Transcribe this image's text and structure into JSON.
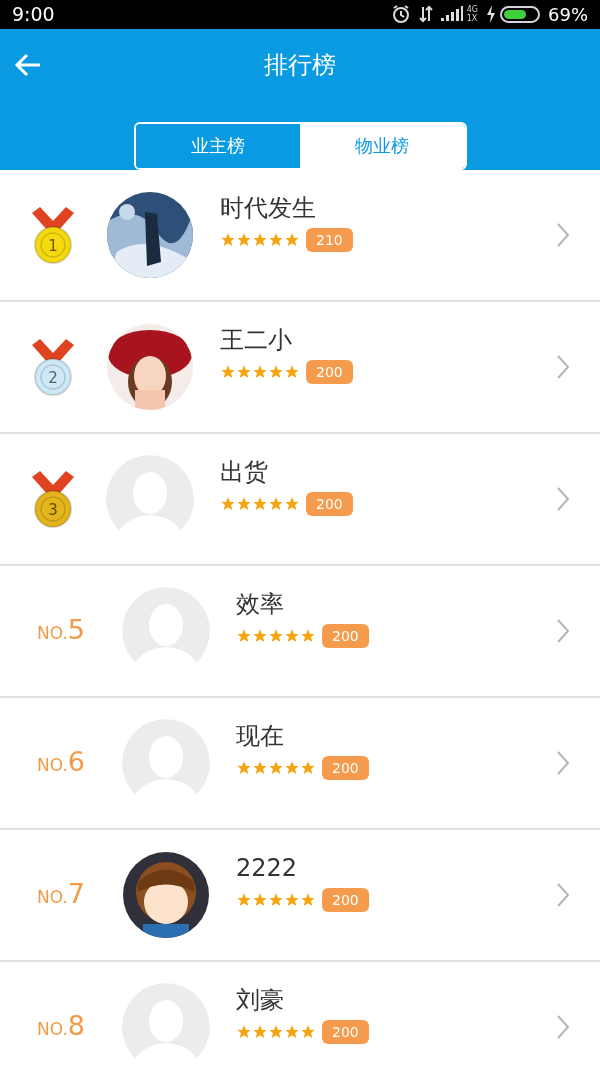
{
  "status_bar": {
    "time": "9:00",
    "network_top": "4G",
    "network_bottom": "1X",
    "battery_text": "69%"
  },
  "header": {
    "title": "排行榜"
  },
  "tabs": [
    {
      "label": "业主榜",
      "selected": true
    },
    {
      "label": "物业榜",
      "selected": false
    }
  ],
  "rows": [
    {
      "kind": "medal",
      "color": "#f5d90f",
      "rank": "1",
      "name": "时代发生",
      "stars": 5,
      "score": "210"
    },
    {
      "kind": "medal",
      "color": "#cde9f7",
      "rank": "2",
      "name": "王二小",
      "stars": 5,
      "score": "200"
    },
    {
      "kind": "medal",
      "color": "#e3b41c",
      "rank": "3",
      "avatar": {
        "kind": "default"
      },
      "name": "出货",
      "stars": 5,
      "score": "200"
    },
    {
      "kind": "number",
      "rank_prefix": "NO.",
      "rank": "5",
      "avatar": {
        "kind": "default"
      },
      "name": "效率",
      "stars": 5,
      "score": "200"
    },
    {
      "kind": "number",
      "rank_prefix": "NO.",
      "rank": "6",
      "avatar": {
        "kind": "default"
      },
      "name": "现在",
      "stars": 5,
      "score": "200"
    },
    {
      "kind": "number",
      "rank_prefix": "NO.",
      "rank": "7",
      "name": "2222",
      "stars": 5,
      "score": "200"
    },
    {
      "kind": "number",
      "rank_prefix": "NO.",
      "rank": "8",
      "avatar": {
        "kind": "default"
      },
      "name": "刘豪",
      "stars": 5,
      "score": "200"
    }
  ]
}
